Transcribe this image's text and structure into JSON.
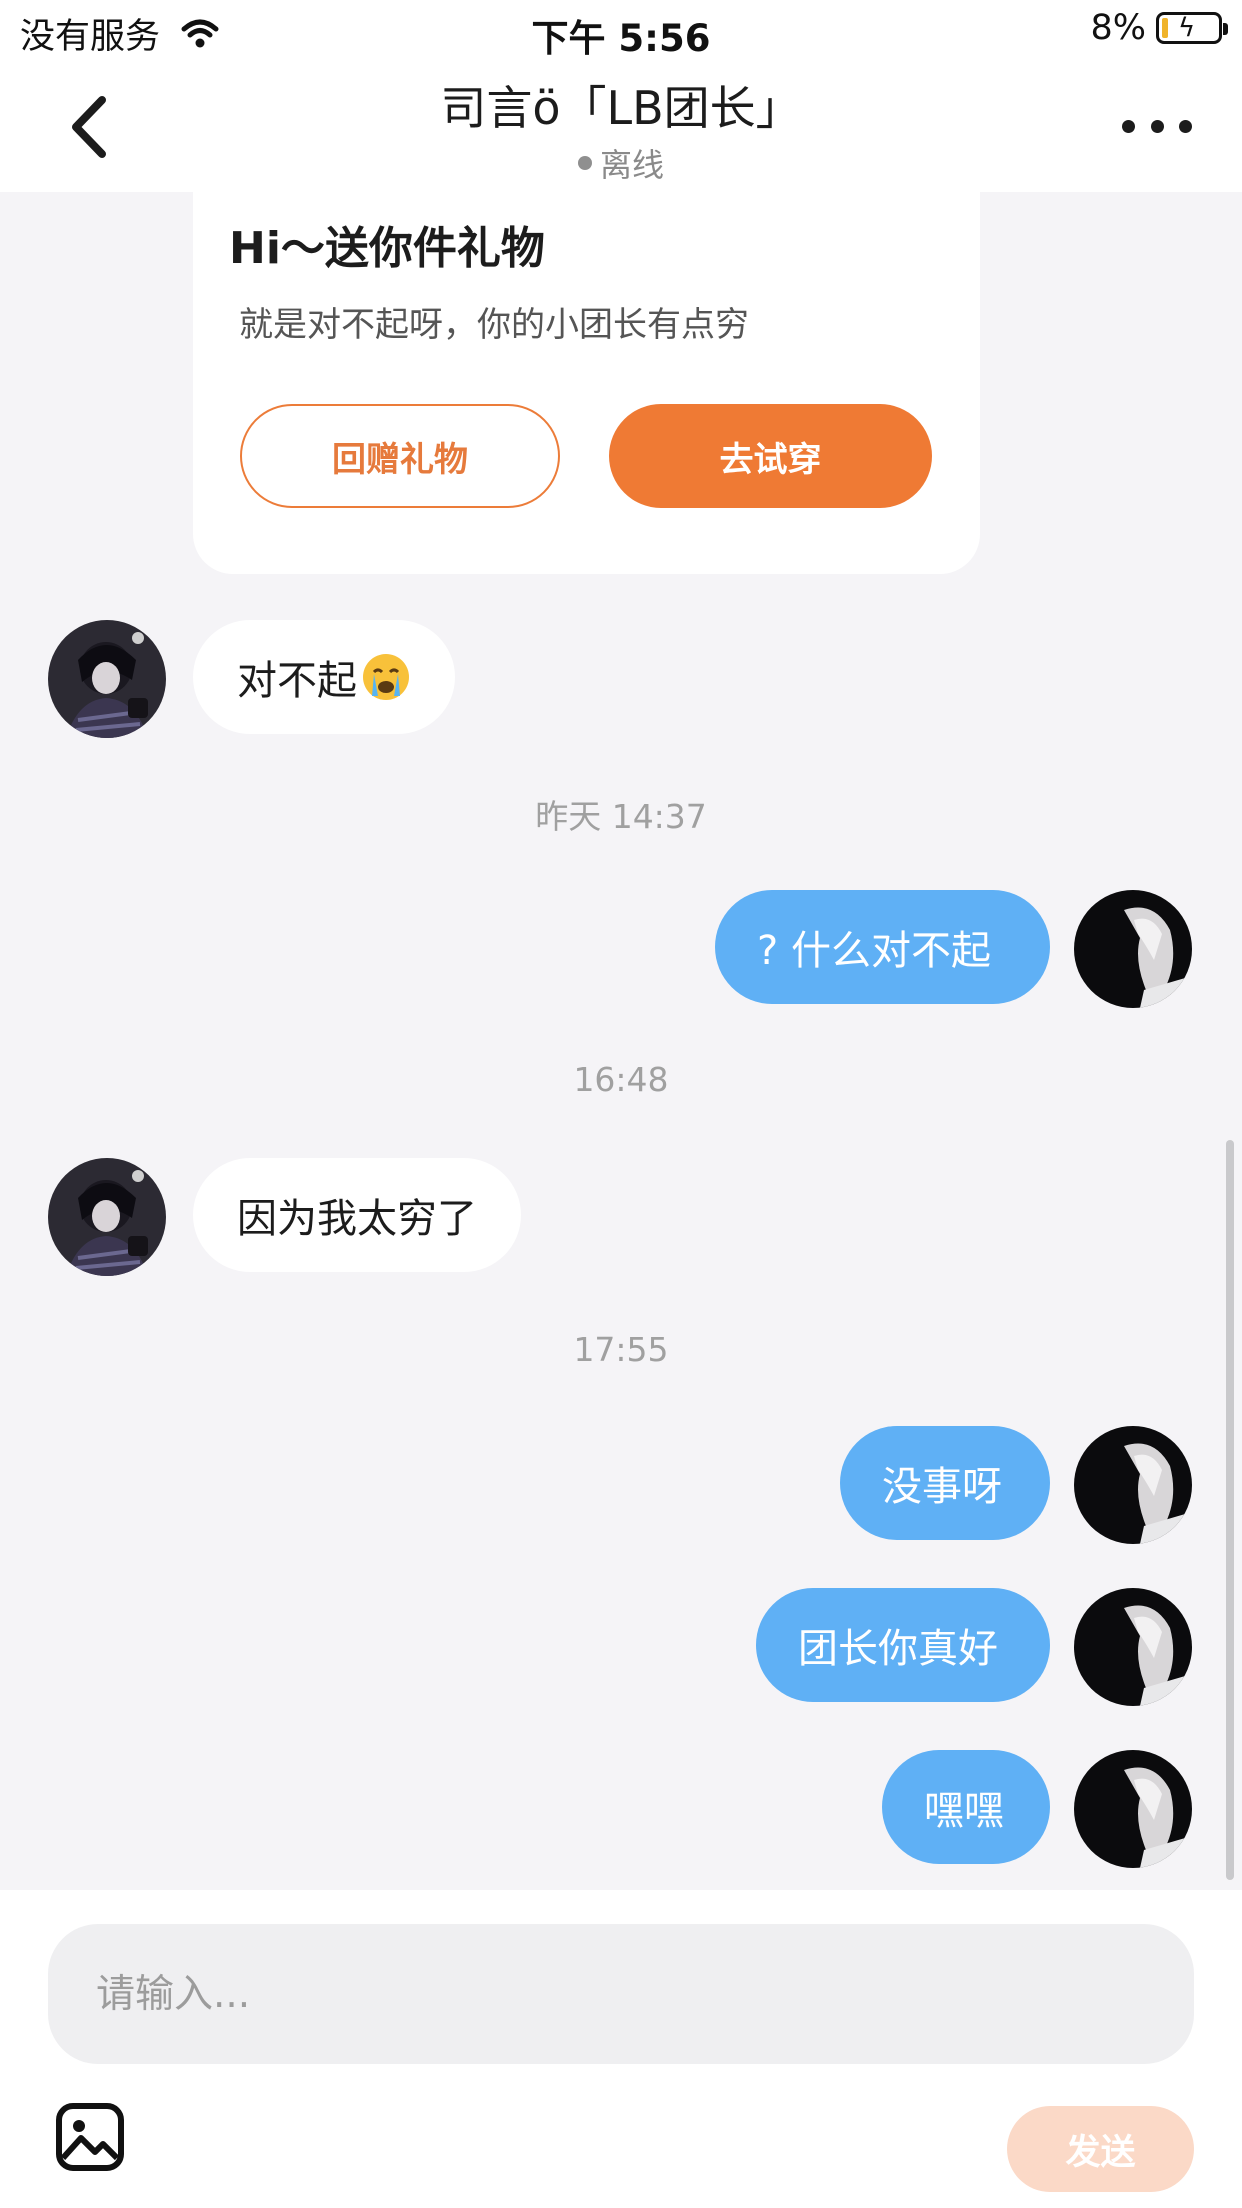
{
  "status_bar": {
    "carrier": "没有服务",
    "time": "下午 5:56",
    "battery": "8%"
  },
  "header": {
    "title": "司言ö「LB团长」",
    "status": "离线"
  },
  "gift_card": {
    "title": "Hi～送你件礼物",
    "subtitle": "就是对不起呀，你的小团长有点穷",
    "return_button": "回赠礼物",
    "try_button": "去试穿"
  },
  "messages": [
    {
      "text": "对不起"
    },
    {
      "text": "? 什么对不起"
    },
    {
      "text": "因为我太穷了"
    },
    {
      "text": "没事呀"
    },
    {
      "text": "团长你真好"
    },
    {
      "text": "嘿嘿"
    }
  ],
  "timestamps": [
    "昨天 14:37",
    "16:48",
    "17:55"
  ],
  "composer": {
    "placeholder": "请输入...",
    "send_label": "发送"
  },
  "colors": {
    "accent_orange": "#ef7a34",
    "my_bubble": "#5fb0f5",
    "send_disabled": "#fbd9c7"
  }
}
